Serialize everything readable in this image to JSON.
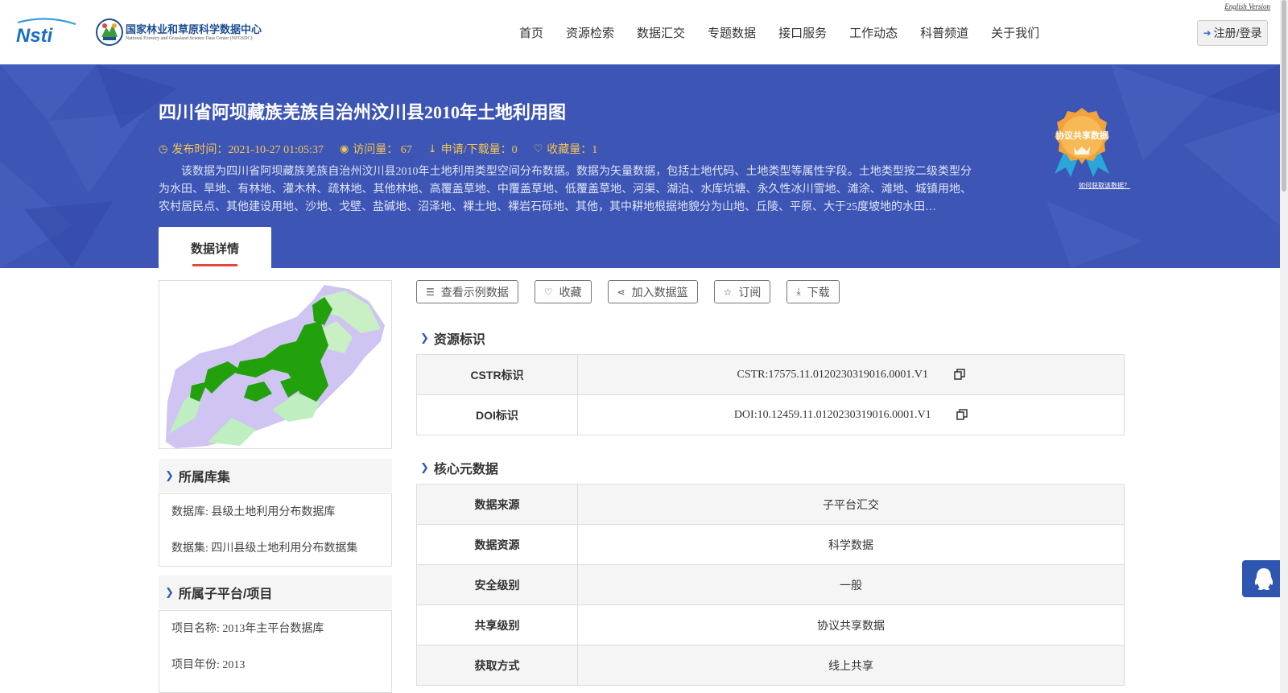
{
  "header": {
    "english_link": "English Version",
    "logo_nsti_text": "Nsti",
    "center_name_cn": "国家林业和草原科学数据中心",
    "center_name_en": "National Forestry and Grassland Science Data Center (NFGSDC)",
    "nav": [
      "首页",
      "资源检索",
      "数据汇交",
      "专题数据",
      "接口服务",
      "工作动态",
      "科普频道",
      "关于我们"
    ],
    "login_label": "注册/登录"
  },
  "banner": {
    "title": "四川省阿坝藏族羌族自治州汶川县2010年土地利用图",
    "publish_time": "发布时间：2021-10-27 01:05:37",
    "visits": "访问量： 67",
    "downloads": "申请/下载量：0",
    "favorites": "收藏量：1",
    "description": "该数据为四川省阿坝藏族羌族自治州汶川县2010年土地利用类型空间分布数据。数据为矢量数据，包括土地代码、土地类型等属性字段。土地类型按二级类型分为水田、旱地、有林地、灌木林、疏林地、其他林地、高覆盖草地、中覆盖草地、低覆盖草地、河渠、湖泊、水库坑塘、永久性冰川雪地、滩涂、滩地、城镇用地、农村居民点、其他建设用地、沙地、戈壁、盐碱地、沼泽地、裸土地、裸岩石砾地、其他，其中耕地根据地貌分为山地、丘陵、平原、大于25度坡地的水田…",
    "badge_text": "协议共享数据",
    "badge_link": "如何获取该数据？",
    "tab_label": "数据详情"
  },
  "left": {
    "library_title": "所属库集",
    "database": "数据库: 县级土地利用分布数据库",
    "dataset": "数据集: 四川县级土地利用分布数据集",
    "platform_title": "所属子平台/项目",
    "project_name": "项目名称: 2013年主平台数据库",
    "project_year": "项目年份: 2013"
  },
  "actions": {
    "sample": "查看示例数据",
    "favorite": "收藏",
    "basket": "加入数据篮",
    "subscribe": "订阅",
    "download": "下载"
  },
  "resource_id": {
    "title": "资源标识",
    "rows": [
      {
        "key": "CSTR标识",
        "value": "CSTR:17575.11.0120230319016.0001.V1"
      },
      {
        "key": "DOI标识",
        "value": "DOI:10.12459.11.0120230319016.0001.V1"
      }
    ]
  },
  "core_meta": {
    "title": "核心元数据",
    "rows": [
      {
        "key": "数据来源",
        "value": "子平台汇交"
      },
      {
        "key": "数据资源",
        "value": "科学数据"
      },
      {
        "key": "安全级别",
        "value": "一般"
      },
      {
        "key": "共享级别",
        "value": "协议共享数据"
      },
      {
        "key": "获取方式",
        "value": "线上共享"
      }
    ]
  },
  "colors": {
    "banner": "#3d56b6",
    "meta_text": "#f5c451",
    "accent_red": "#e2473b",
    "link_blue": "#2e5ab8"
  }
}
